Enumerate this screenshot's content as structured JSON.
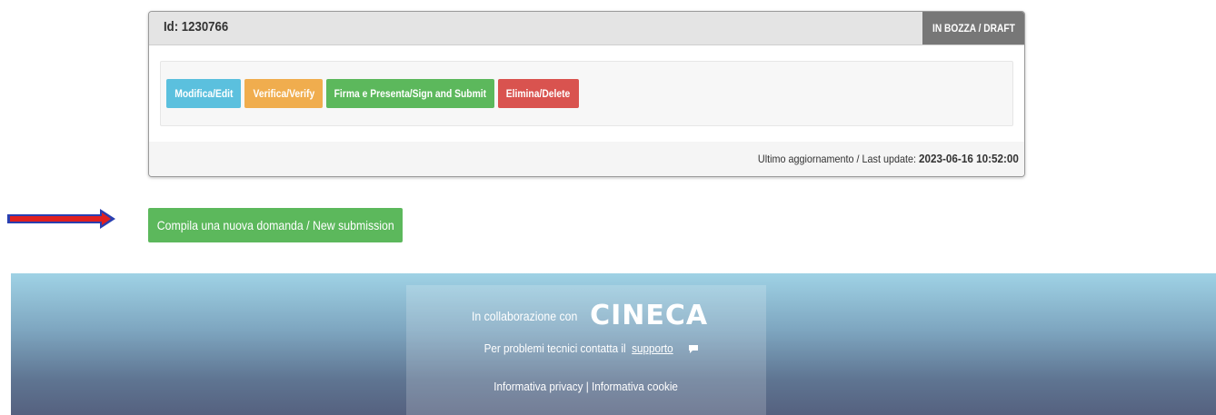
{
  "card": {
    "id_label": "Id: 1230766",
    "status": "IN BOZZA / DRAFT",
    "status_color": "#777777",
    "actions": [
      {
        "label": "Modifica/Edit",
        "color": "#5bc0de"
      },
      {
        "label": "Verifica/Verify",
        "color": "#f0ad4e"
      },
      {
        "label": "Firma e Presenta/Sign and Submit",
        "color": "#5cb85c"
      },
      {
        "label": "Elimina/Delete",
        "color": "#d9534f"
      }
    ],
    "last_update_label": "Ultimo aggiornamento / Last update: ",
    "last_update_value": "2023-06-16 10:52:00"
  },
  "annotation": {
    "icon": "red-arrow-icon",
    "color": "#e02020"
  },
  "new_submission": {
    "label": "Compila una nuova domanda / New submission",
    "color": "#5cb85c"
  },
  "footer": {
    "collab_text": "In collaborazione con",
    "logo_text": "CINECA",
    "support_text": "Per problemi tecnici contatta il",
    "support_link": "supporto",
    "support_icon": "chat-bubble-icon",
    "privacy_link": "Informativa privacy",
    "separator": " | ",
    "cookie_link": "Informativa cookie"
  }
}
